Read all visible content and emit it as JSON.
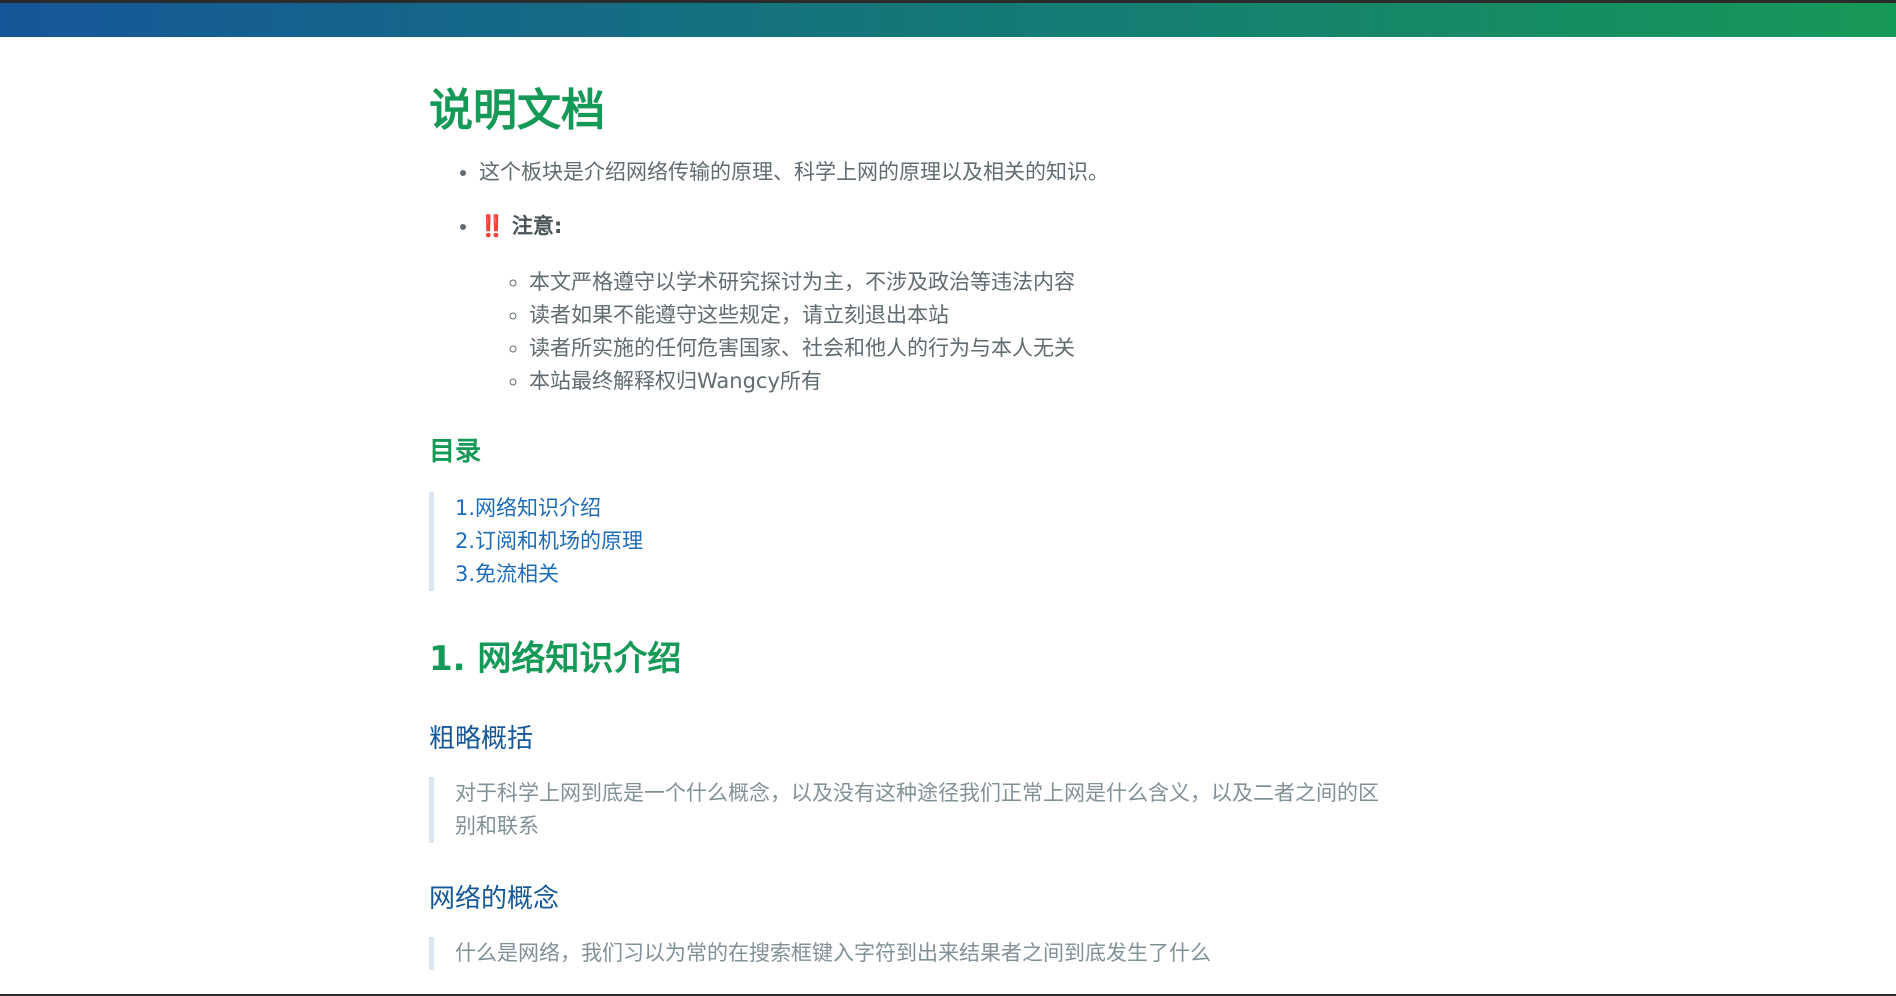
{
  "doc": {
    "title": "说明文档",
    "intro": "这个板块是介绍网络传输的原理、科学上网的原理以及相关的知识。",
    "notice_prefix": "‼️",
    "notice_label": "注意:",
    "notice_items": [
      "本文严格遵守以学术研究探讨为主，不涉及政治等违法内容",
      "读者如果不能遵守这些规定，请立刻退出本站",
      "读者所实施的任何危害国家、社会和他人的行为与本人无关",
      "本站最终解释权归Wangcy所有"
    ]
  },
  "toc": {
    "heading": "目录",
    "items": [
      "1.网络知识介绍",
      "2.订阅和机场的原理",
      "3.免流相关"
    ]
  },
  "section1": {
    "title": "1. 网络知识介绍",
    "subsections": [
      {
        "heading": "粗略概括",
        "text": "对于科学上网到底是一个什么概念，以及没有这种途径我们正常上网是什么含义，以及二者之间的区别和联系"
      },
      {
        "heading": "网络的概念",
        "text": "什么是网络，我们习以为常的在搜索框键入字符到出来结果者之间到底发生了什么"
      }
    ]
  },
  "colors": {
    "header_gradient_start": "#155799",
    "header_gradient_end": "#159957",
    "heading_green": "#159957",
    "link_blue": "#1e6bb8",
    "text_gray": "#606c71"
  }
}
